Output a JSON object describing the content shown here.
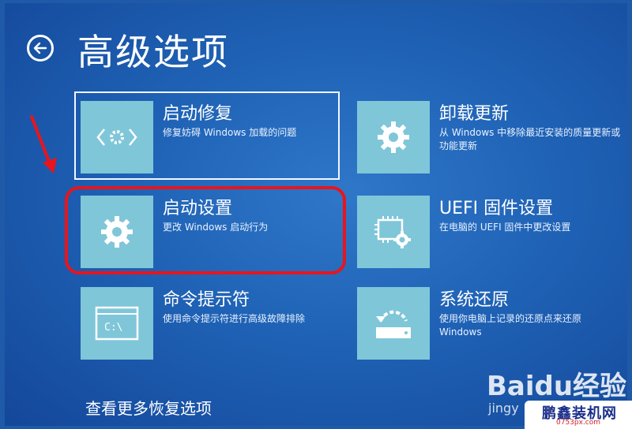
{
  "header": {
    "title": "高级选项"
  },
  "options": [
    {
      "name": "启动修复",
      "description": "修复妨碍 Windows 加载的问题"
    },
    {
      "name": "卸载更新",
      "description": "从 Windows 中移除最近安装的质量更新或功能更新"
    },
    {
      "name": "启动设置",
      "description": "更改 Windows 启动行为"
    },
    {
      "name": "UEFI 固件设置",
      "description": "在电脑的 UEFI 固件中更改设置"
    },
    {
      "name": "命令提示符",
      "description": "使用命令提示符进行高级故障排除"
    },
    {
      "name": "系统还原",
      "description": "使用你电脑上记录的还原点来还原 Windows"
    }
  ],
  "cmd_icon_text": "C:\\",
  "footer": {
    "more_options": "查看更多恢复选项"
  },
  "watermark": {
    "brand": "Baidu经验",
    "sub": "jingy",
    "badge_name": "鹏鑫装机网",
    "badge_url": "0753px.com"
  },
  "colors": {
    "background": "#1f62b5",
    "tile": "#7fc6d9",
    "highlight": "#e8151c"
  }
}
